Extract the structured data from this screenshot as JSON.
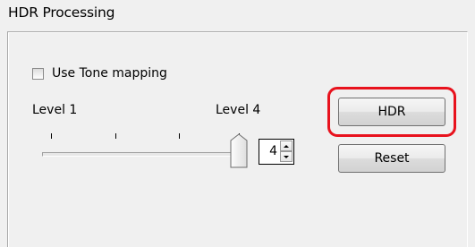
{
  "dialog": {
    "title": "HDR Processing"
  },
  "tone_mapping": {
    "label": "Use Tone mapping",
    "checked": false
  },
  "slider": {
    "min_label": "Level 1",
    "max_label": "Level 4",
    "min": 1,
    "max": 4,
    "value": 4
  },
  "spinner": {
    "value": "4"
  },
  "buttons": {
    "hdr_label": "HDR",
    "reset_label": "Reset"
  },
  "colors": {
    "highlight": "#e8121d",
    "background": "#f0f0f0"
  },
  "icons": {
    "spin_up": "chevron-up-icon",
    "spin_down": "chevron-down-icon"
  }
}
